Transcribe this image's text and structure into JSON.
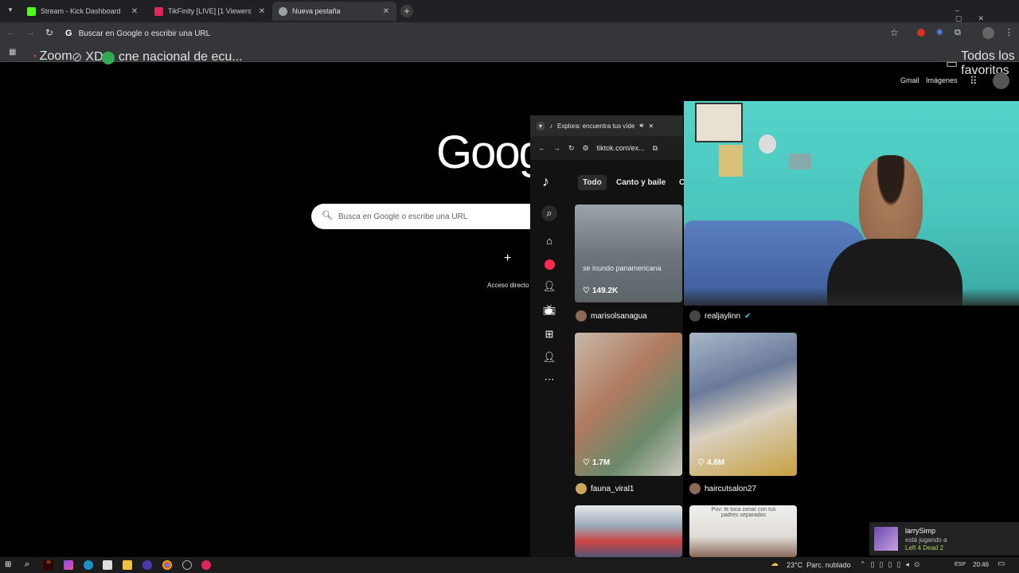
{
  "tabs": [
    {
      "label": "Stream - Kick Dashboard",
      "icon": "kick-icon"
    },
    {
      "label": "TikFinity [LIVE] [1 Viewers]",
      "icon": "tikfinity-icon"
    },
    {
      "label": "Nueva pestaña",
      "icon": "chrome-icon"
    }
  ],
  "omnibox": {
    "text": "Buscar en Google o escribir una URL"
  },
  "bookmarks": {
    "items": [
      "Zoom",
      "XD",
      "cne nacional de ecu..."
    ],
    "all": "Todos los favoritos"
  },
  "google": {
    "logo_partial": "Goog",
    "gmail": "Gmail",
    "images": "Imágenes",
    "search_placeholder": "Busca en Google o escribe una URL",
    "shortcut_label": "Acceso directo"
  },
  "tiktok": {
    "tab_title": "Explora: encuentra tus víde",
    "url": "tiktok.com/ex...",
    "categories": [
      "Todo",
      "Canto y baile",
      "C"
    ],
    "cards": [
      {
        "likes": "149.2K",
        "user": "marisolsanagua",
        "overlay": "se inundo panamericana"
      },
      {
        "likes": "",
        "user": "realjaylinn"
      },
      {
        "likes": "1.7M",
        "user": "fauna_viral1"
      },
      {
        "likes": "4.8M",
        "user": "haircutsalon27"
      },
      {
        "overlay": ""
      },
      {
        "overlay": "Pov: te toca cenar con tus padres separados"
      }
    ]
  },
  "notification": {
    "user": "larrySimp",
    "line1": "está jugando a",
    "line2": "Left 4 Dead 2"
  },
  "taskbar": {
    "weather": "23°C  Parc. nublado",
    "lang": "ESP",
    "time": "20:46"
  }
}
